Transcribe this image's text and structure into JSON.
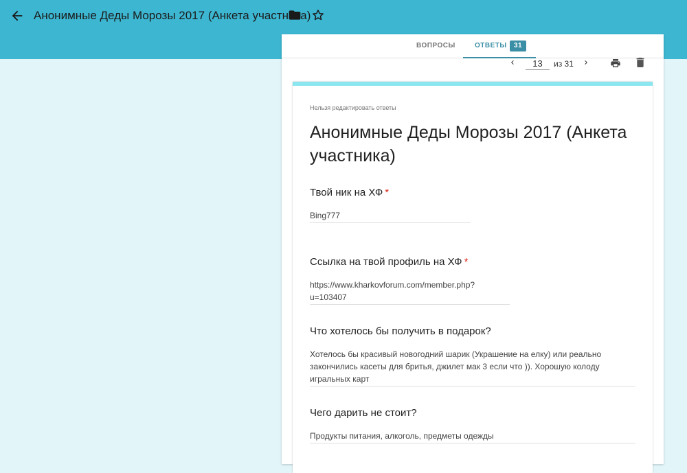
{
  "header": {
    "title": "Анонимные Деды Морозы 2017 (Анкета участника)",
    "back_icon": "arrow-back-icon",
    "folder_icon": "folder-icon",
    "star_icon": "star-outline-icon"
  },
  "tabs": {
    "questions_label": "ВОПРОСЫ",
    "answers_label": "ОТВЕТЫ",
    "answers_count": "31"
  },
  "pager": {
    "current": "13",
    "of_label": "из 31",
    "prev_icon": "chevron-left-icon",
    "next_icon": "chevron-right-icon",
    "print_icon": "print-icon",
    "delete_icon": "trash-icon"
  },
  "form": {
    "notice": "Нельзя редактировать ответы",
    "title": "Анонимные Деды Морозы 2017 (Анкета участника)",
    "questions": [
      {
        "label": "Твой ник на ХФ",
        "required_mark": "*",
        "answer": "Bing777"
      },
      {
        "label": "Ссылка на твой профиль на ХФ",
        "required_mark": "*",
        "answer": "https://www.kharkovforum.com/member.php?u=103407"
      },
      {
        "label": "Что хотелось бы получить в подарок?",
        "answer": "Хотелось бы красивый новогодний шарик (Украшение на елку) или реально закончились касеты для бритья, джилет мак 3 если что )). Хорошую колоду игральных карт"
      },
      {
        "label": "Чего дарить не стоит?",
        "answer": "Продукты питания, алкоголь, предметы одежды"
      }
    ]
  },
  "colors": {
    "header_bg": "#3db6d1",
    "page_bg": "#e2f5f9",
    "accent": "#3a8ea5",
    "card_top_border": "#8be6ef",
    "required": "#d93025"
  }
}
